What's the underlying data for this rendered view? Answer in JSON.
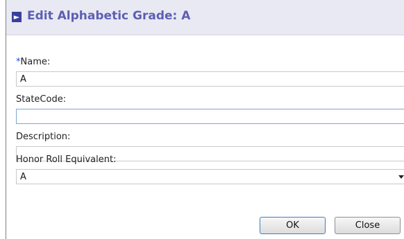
{
  "dialog": {
    "title": "Edit Alphabetic Grade: A",
    "title_icon": "collapse-arrow-icon"
  },
  "fields": {
    "name": {
      "required_marker": "*",
      "label": "Name:",
      "value": "A"
    },
    "state_code": {
      "label": "StateCode:",
      "value": ""
    },
    "description": {
      "label": "Description:",
      "value": ""
    },
    "honor_roll": {
      "label": "Honor Roll Equivalent:",
      "selected": "A"
    }
  },
  "buttons": {
    "ok": "OK",
    "close": "Close"
  }
}
